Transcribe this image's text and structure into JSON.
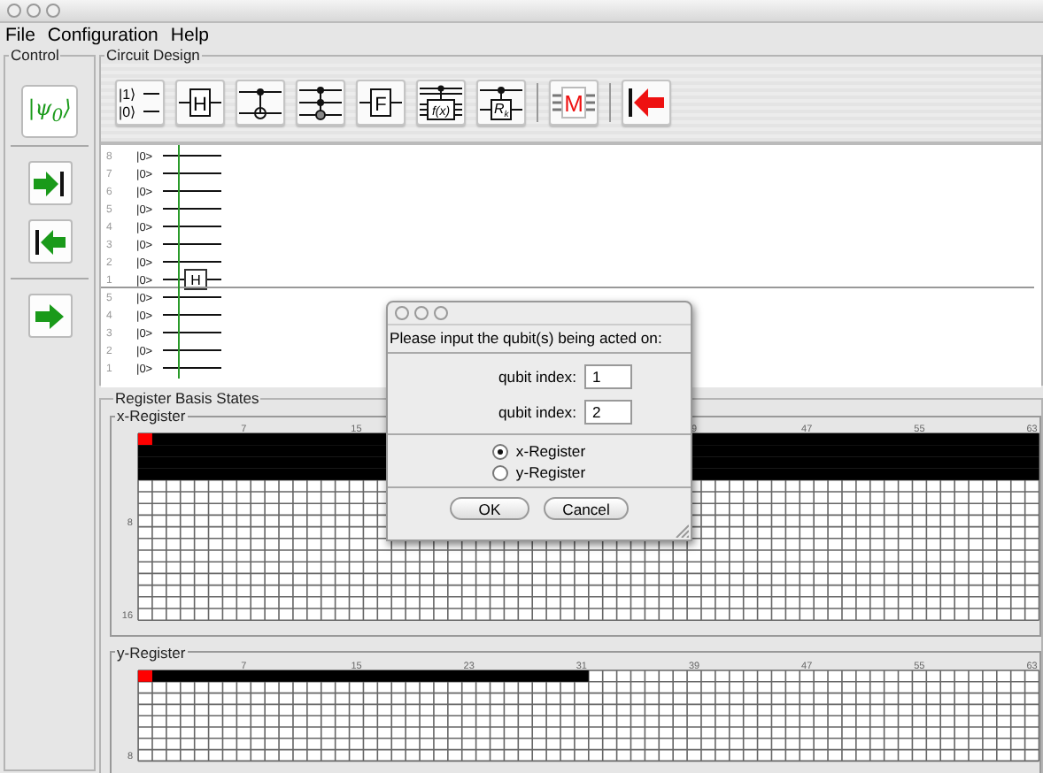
{
  "menu": [
    "File",
    "Configuration",
    "Help"
  ],
  "control": {
    "title": "Control",
    "psi_button": "|ψ$_{0}$⟩",
    "buttons": [
      {
        "kind": "step_forward"
      },
      {
        "kind": "step_back"
      },
      {
        "kind": "run"
      }
    ]
  },
  "circuit_design": {
    "title": "Circuit Design",
    "toolbar": [
      {
        "kind": "ket",
        "labels": [
          "|1⟩",
          "|0⟩"
        ]
      },
      {
        "kind": "gate",
        "label": "H"
      },
      {
        "kind": "cnot"
      },
      {
        "kind": "toffoli"
      },
      {
        "kind": "gate",
        "label": "F"
      },
      {
        "kind": "oracle",
        "label": "f(x)"
      },
      {
        "kind": "controlled",
        "label": "R",
        "subscript": "k"
      },
      {
        "kind": "separator"
      },
      {
        "kind": "measure",
        "label": "M"
      },
      {
        "kind": "separator"
      },
      {
        "kind": "undo"
      }
    ],
    "qubit_groups": [
      {
        "qubits": [
          {
            "number": "8",
            "state": "|0>"
          },
          {
            "number": "7",
            "state": "|0>"
          },
          {
            "number": "6",
            "state": "|0>"
          },
          {
            "number": "5",
            "state": "|0>"
          },
          {
            "number": "4",
            "state": "|0>"
          },
          {
            "number": "3",
            "state": "|0>"
          },
          {
            "number": "2",
            "state": "|0>"
          },
          {
            "number": "1",
            "state": "|0>",
            "gate": "H"
          }
        ]
      },
      {
        "qubits": [
          {
            "number": "5",
            "state": "|0>"
          },
          {
            "number": "4",
            "state": "|0>"
          },
          {
            "number": "3",
            "state": "|0>"
          },
          {
            "number": "2",
            "state": "|0>"
          },
          {
            "number": "1",
            "state": "|0>"
          }
        ]
      }
    ]
  },
  "register_basis_states": {
    "title": "Register Basis States",
    "registers": [
      {
        "title": "x-Register",
        "column_labels": [
          {
            "kind": "label",
            "text": "7"
          },
          {
            "kind": "label",
            "text": "15"
          },
          {
            "kind": "gap"
          },
          {
            "kind": "gap"
          },
          {
            "kind": "label",
            "text": "9"
          },
          {
            "kind": "label",
            "text": "47"
          },
          {
            "kind": "label",
            "text": "55"
          },
          {
            "kind": "label",
            "text": "63"
          }
        ],
        "row_labels": [
          "8",
          "16"
        ],
        "filled_rows": [
          {
            "level": 1,
            "marked": true
          },
          {
            "level": 1,
            "marked": false
          },
          {
            "level": 1,
            "marked": false
          },
          {
            "level": 1,
            "marked": false
          }
        ]
      },
      {
        "title": "y-Register",
        "column_labels": [
          {
            "kind": "label",
            "text": "7"
          },
          {
            "kind": "label",
            "text": "15"
          },
          {
            "kind": "label",
            "text": "23"
          },
          {
            "kind": "label",
            "text": "31"
          },
          {
            "kind": "label",
            "text": "39"
          },
          {
            "kind": "label",
            "text": "47"
          },
          {
            "kind": "label",
            "text": "55"
          },
          {
            "kind": "label",
            "text": "63"
          }
        ],
        "row_labels": [
          "8"
        ],
        "filled_rows": [
          {
            "level": 0.5,
            "marked": true
          }
        ]
      }
    ]
  },
  "dialog": {
    "prompt": "Please input the qubit(s) being acted on:",
    "fields": [
      {
        "label": "qubit index:",
        "value": "1"
      },
      {
        "label": "qubit index:",
        "value": "2"
      }
    ],
    "options": [
      {
        "label": "x-Register",
        "selected": true
      },
      {
        "label": "y-Register",
        "selected": false
      }
    ],
    "buttons": [
      "OK",
      "Cancel"
    ]
  }
}
